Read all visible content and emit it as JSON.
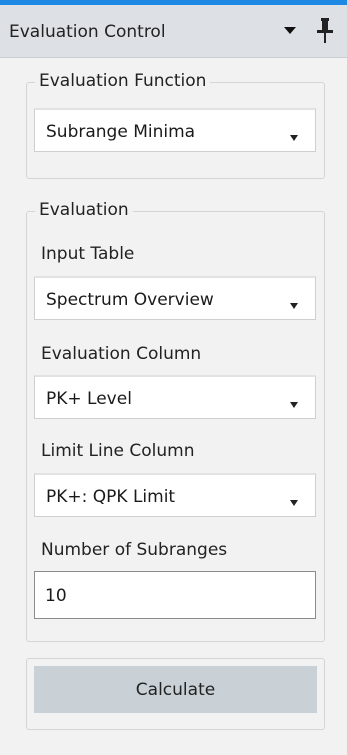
{
  "header": {
    "title": "Evaluation Control",
    "dropdown_icon": "triangle-down-icon",
    "pin_icon": "pin-icon"
  },
  "evaluation_function_group": {
    "legend": "Evaluation Function",
    "function_select": {
      "value": "Subrange Minima",
      "icon": "chevron-down-icon"
    }
  },
  "evaluation_group": {
    "legend": "Evaluation",
    "input_table": {
      "label": "Input Table",
      "value": "Spectrum Overview"
    },
    "evaluation_column": {
      "label": "Evaluation Column",
      "value": "PK+ Level"
    },
    "limit_line_column": {
      "label": "Limit Line Column",
      "value": "PK+: QPK Limit"
    },
    "number_of_subranges": {
      "label": "Number of Subranges",
      "value": "10"
    }
  },
  "actions": {
    "calculate_label": "Calculate"
  },
  "colors": {
    "accent": "#1e88e5",
    "header_bg": "#dde1e5",
    "panel_bg": "#f2f2f2",
    "button_bg": "#c9d1d6"
  }
}
